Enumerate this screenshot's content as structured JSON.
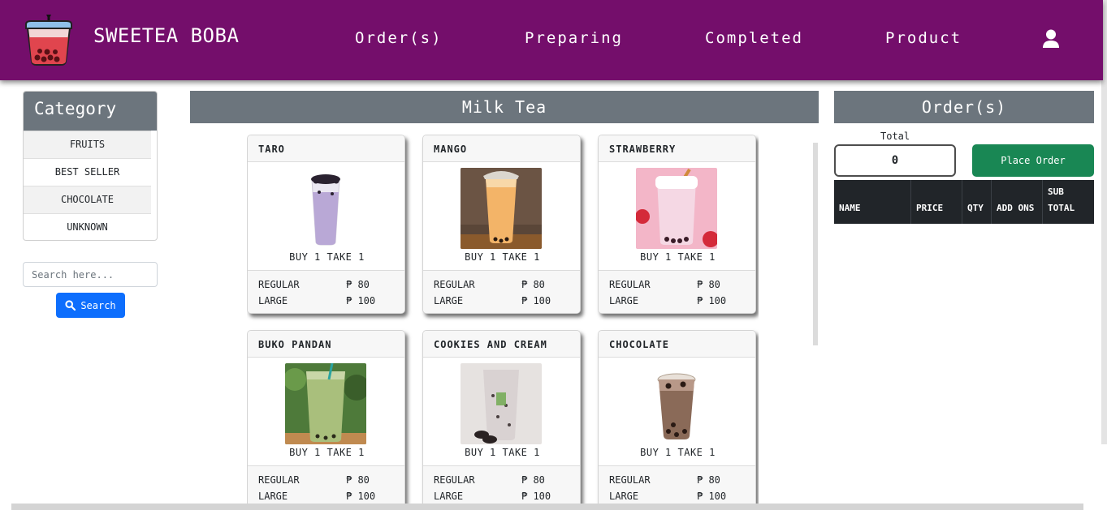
{
  "header": {
    "brand": "SWEETEA BOBA",
    "nav": [
      "Order(s)",
      "Preparing",
      "Completed",
      "Product"
    ],
    "icons": {
      "logo": "boba-cup-logo",
      "user": "user-icon"
    },
    "background": "#740e6b"
  },
  "sidebar": {
    "title": "Category",
    "categories": [
      "FRUITS",
      "BEST SELLER",
      "CHOCOLATE",
      "UNKNOWN"
    ],
    "search_placeholder": "Search here...",
    "search_label": "Search"
  },
  "main": {
    "title": "Milk Tea",
    "products": [
      {
        "name": "TARO",
        "promo": "BUY 1 TAKE 1",
        "prices": [
          {
            "size": "REGULAR",
            "price": "₱ 80"
          },
          {
            "size": "LARGE",
            "price": "₱ 100"
          }
        ]
      },
      {
        "name": "MANGO",
        "promo": "BUY 1 TAKE 1",
        "prices": [
          {
            "size": "REGULAR",
            "price": "₱ 80"
          },
          {
            "size": "LARGE",
            "price": "₱ 100"
          }
        ]
      },
      {
        "name": "STRAWBERRY",
        "promo": "BUY 1 TAKE 1",
        "prices": [
          {
            "size": "REGULAR",
            "price": "₱ 80"
          },
          {
            "size": "LARGE",
            "price": "₱ 100"
          }
        ]
      },
      {
        "name": "BUKO PANDAN",
        "promo": "BUY 1 TAKE 1",
        "prices": [
          {
            "size": "REGULAR",
            "price": "₱ 80"
          },
          {
            "size": "LARGE",
            "price": "₱ 100"
          }
        ]
      },
      {
        "name": "COOKIES AND CREAM",
        "promo": "BUY 1 TAKE 1",
        "prices": [
          {
            "size": "REGULAR",
            "price": "₱ 80"
          },
          {
            "size": "LARGE",
            "price": "₱ 100"
          }
        ]
      },
      {
        "name": "CHOCOLATE",
        "promo": "BUY 1 TAKE 1",
        "prices": [
          {
            "size": "REGULAR",
            "price": "₱ 80"
          },
          {
            "size": "LARGE",
            "price": "₱ 100"
          }
        ]
      }
    ]
  },
  "orders": {
    "title": "Order(s)",
    "total_label": "Total",
    "total_value": "0",
    "place_order_label": "Place Order",
    "columns": [
      "NAME",
      "PRICE",
      "QTY",
      "ADD ONS",
      "SUB TOTAL"
    ]
  },
  "colors": {
    "header": "#740e6b",
    "panel_header": "#6c757d",
    "search_button": "#0d6efd",
    "place_order_button": "#198754",
    "table_header": "#212529"
  }
}
